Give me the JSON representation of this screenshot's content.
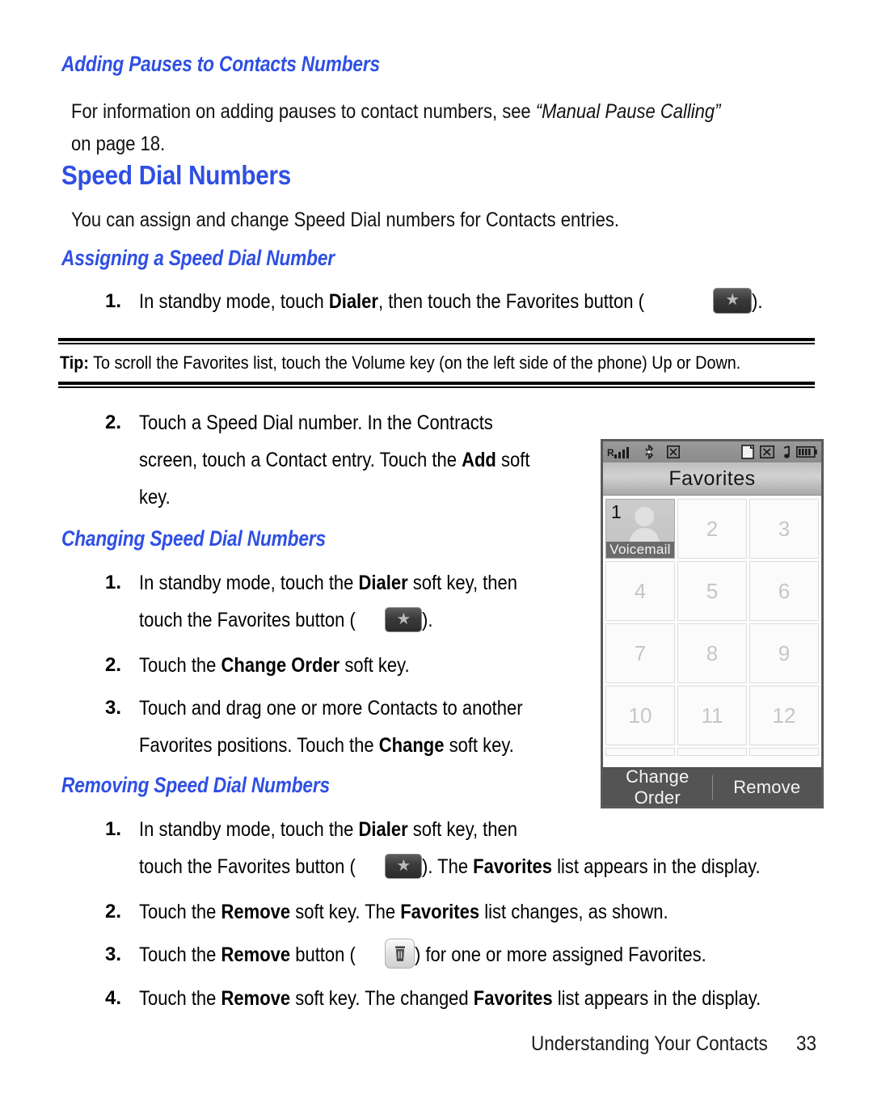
{
  "colors": {
    "heading_blue": "#2f4fe3",
    "body_text": "#111111",
    "phone_softkey_bg": "#545454"
  },
  "sections": {
    "adding_pauses": {
      "heading": "Adding Pauses to Contacts Numbers",
      "paragraph_part1": "For information on adding pauses to contact numbers, see ",
      "paragraph_italic": "“Manual Pause Calling”",
      "paragraph_part2": "on page 18."
    },
    "speed_dial": {
      "heading": "Speed Dial Numbers",
      "intro": "You can assign and change Speed Dial numbers for Contacts entries."
    },
    "assigning": {
      "heading": "Assigning a Speed Dial Number",
      "step1": {
        "number": "1.",
        "text_a": "In standby mode, touch ",
        "bold_a": "Dialer",
        "text_b": ", then touch the Favorites button (",
        "text_c": ")."
      },
      "step2": {
        "number": "2.",
        "line1": "Touch a Speed Dial number. In the Contracts",
        "line2_a": "screen, touch a Contact entry. Touch the ",
        "line2_bold": "Add",
        "line2_b": " soft",
        "line3": "key."
      }
    },
    "tip": {
      "label": "Tip:",
      "text": " To scroll the Favorites list, touch the Volume key (on the left side of the phone) Up or Down."
    },
    "changing": {
      "heading": "Changing Speed Dial Numbers",
      "step1": {
        "number": "1.",
        "line1_a": "In standby mode, touch the ",
        "line1_bold": "Dialer",
        "line1_b": " soft key, then",
        "line2_a": "touch the Favorites button (",
        "line2_b": ")."
      },
      "step2": {
        "number": "2.",
        "text_a": "Touch the ",
        "bold_a": "Change Order",
        "text_b": " soft key."
      },
      "step3": {
        "number": "3.",
        "line1": "Touch and drag one or more Contacts to another",
        "line2_a": "Favorites positions. Touch the ",
        "line2_bold": "Change",
        "line2_b": " soft key."
      }
    },
    "removing": {
      "heading": "Removing Speed Dial Numbers",
      "step1": {
        "number": "1.",
        "line1_a": "In standby mode, touch the ",
        "line1_bold": "Dialer",
        "line1_b": " soft key, then",
        "line2_a": "touch the Favorites button (",
        "line2_b": "). The ",
        "line2_bold": "Favorites",
        "line2_c": " list appears in the display."
      },
      "step2": {
        "number": "2.",
        "text_a": "Touch the ",
        "bold_a": "Remove",
        "text_b": " soft key. The ",
        "bold_b": "Favorites",
        "text_c": " list changes, as shown."
      },
      "step3": {
        "number": "3.",
        "text_a": "Touch the ",
        "bold_a": "Remove",
        "text_b": " button (",
        "text_c": ") for one or more assigned Favorites."
      },
      "step4": {
        "number": "4.",
        "text_a": "Touch the ",
        "bold_a": "Remove",
        "text_b": " soft key. The changed ",
        "bold_b": "Favorites",
        "text_c": " list appears in the display."
      }
    }
  },
  "phone_screen": {
    "title": "Favorites",
    "status_icons": [
      "signal-roaming-icon",
      "bluetooth-icon",
      "tty-icon",
      "memo-icon",
      "mute-icon",
      "music-note-icon",
      "battery-icon"
    ],
    "grid": [
      {
        "index": "1",
        "label": "Voicemail",
        "assigned": true
      },
      {
        "index": "2",
        "label": "",
        "assigned": false
      },
      {
        "index": "3",
        "label": "",
        "assigned": false
      },
      {
        "index": "4",
        "label": "",
        "assigned": false
      },
      {
        "index": "5",
        "label": "",
        "assigned": false
      },
      {
        "index": "6",
        "label": "",
        "assigned": false
      },
      {
        "index": "7",
        "label": "",
        "assigned": false
      },
      {
        "index": "8",
        "label": "",
        "assigned": false
      },
      {
        "index": "9",
        "label": "",
        "assigned": false
      },
      {
        "index": "10",
        "label": "",
        "assigned": false
      },
      {
        "index": "11",
        "label": "",
        "assigned": false
      },
      {
        "index": "12",
        "label": "",
        "assigned": false
      }
    ],
    "softkey_left": "Change Order",
    "softkey_right": "Remove"
  },
  "footer": {
    "chapter": "Understanding Your Contacts",
    "page_number": "33"
  },
  "icons": {
    "favorites_button": "star-icon",
    "remove_button": "trash-icon"
  }
}
